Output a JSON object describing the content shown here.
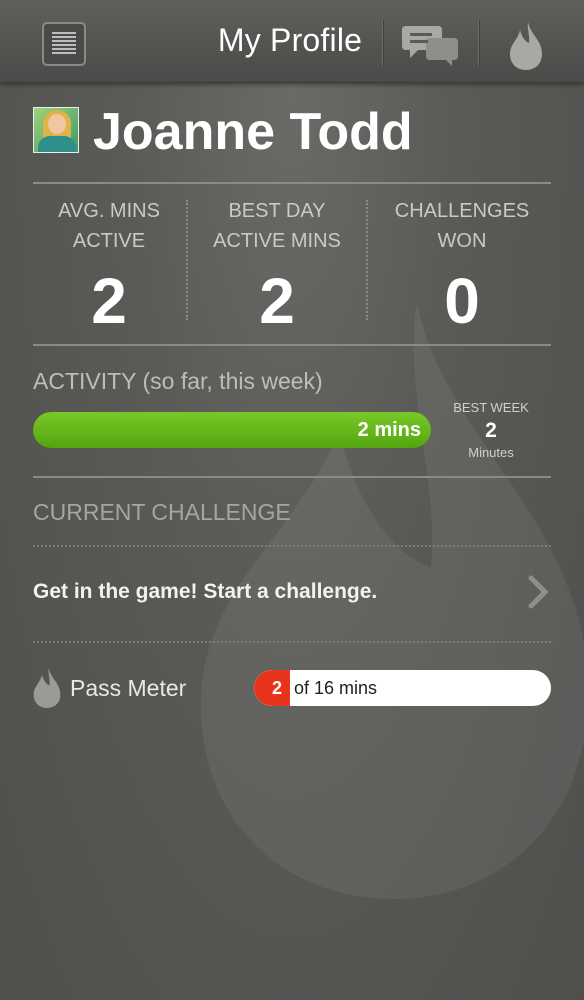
{
  "header": {
    "title": "My Profile",
    "menu_icon": "menu-list-icon",
    "chat_icon": "chat-bubbles-icon",
    "flame_icon": "flame-icon"
  },
  "profile": {
    "name": "Joanne Todd"
  },
  "stats": [
    {
      "label_line1": "AVG. MINS",
      "label_line2": "ACTIVE",
      "value": "2"
    },
    {
      "label_line1": "BEST DAY",
      "label_line2": "ACTIVE MINS",
      "value": "2"
    },
    {
      "label_line1": "CHALLENGES",
      "label_line2": "WON",
      "value": "0"
    }
  ],
  "activity": {
    "label": "ACTIVITY (so far, this week)",
    "bar_text": "2 mins",
    "bar_fraction": 1.0,
    "bar_color": "#6cbc1c",
    "best_week_label": "BEST WEEK",
    "best_week_value": "2",
    "best_week_unit": "Minutes"
  },
  "challenge": {
    "header": "CURRENT CHALLENGE",
    "prompt": "Get in the game! Start a challenge."
  },
  "pass_meter": {
    "label": "Pass Meter",
    "current": "2",
    "total_text": "of 16 mins",
    "fill_color": "#e8341a"
  }
}
